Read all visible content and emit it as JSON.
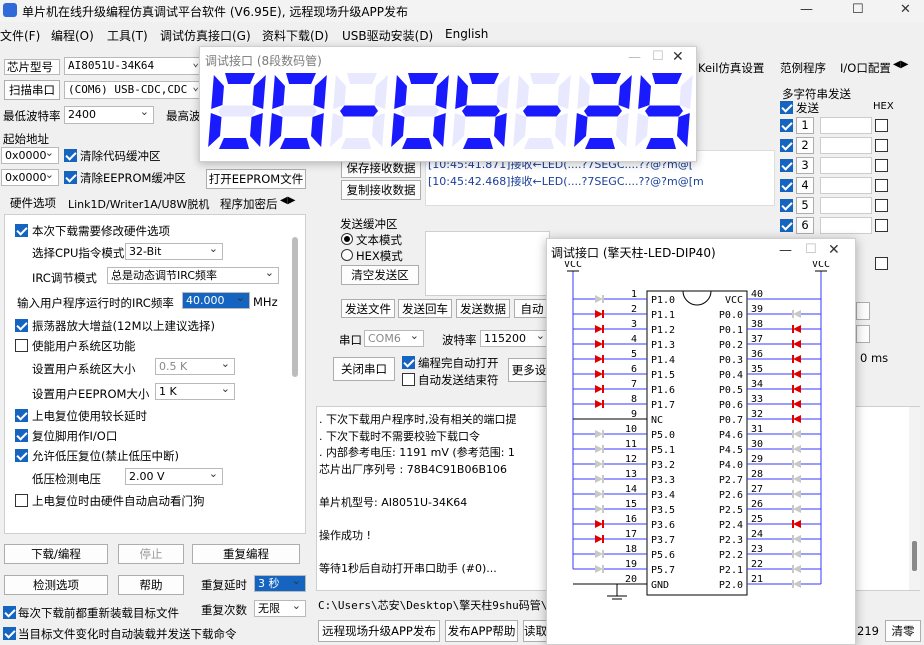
{
  "window": {
    "title": "单片机在线升级编程仿真调试平台软件 (V6.95E), 远程现场升级APP发布"
  },
  "menu": [
    "文件(F)",
    "编程(O)",
    "工具(T)",
    "调试仿真接口(G)",
    "资料下载(D)",
    "USB驱动安装(D)",
    "English"
  ],
  "left": {
    "chip_label": "芯片型号",
    "chip_value": "AI8051U-34K64",
    "scan_button": "扫描串口",
    "port_value": "(COM6) USB-CDC,CDC",
    "min_baud_label": "最低波特率",
    "min_baud_value": "2400",
    "max_baud_label": "最高波",
    "start_addr_label": "起始地址",
    "addr1": "0x0000",
    "clear_code": "清除代码缓冲区",
    "addr2": "0x0000",
    "clear_eeprom": "清除EEPROM缓冲区",
    "open_eeprom": "打开EEPROM文件",
    "tabs": [
      "硬件选项",
      "Link1D/Writer1A/U8W脱机",
      "程序加密后"
    ],
    "opts": {
      "need_modify": "本次下载需要修改硬件选项",
      "cpu_mode_label": "选择CPU指令模式",
      "cpu_mode": "32-Bit",
      "irc_label": "IRC调节模式",
      "irc_mode": "总是动态调节IRC频率",
      "freq_label": "输入用户程序运行时的IRC频率",
      "freq": "40.000",
      "freq_unit": "MHz",
      "osc_gain": "振荡器放大增益(12M以上建议选择)",
      "user_sys": "使能用户系统区功能",
      "sys_size_label": "设置用户系统区大小",
      "sys_size": "0.5 K",
      "eeprom_size_label": "设置用户EEPROM大小",
      "eeprom_size": "1   K",
      "long_delay": "上电复位使用较长延时",
      "reset_io": "复位脚用作I/O口",
      "lvr": "允许低压复位(禁止低压中断)",
      "lvd_label": "低压检测电压",
      "lvd": "2.00 V",
      "watchdog": "上电复位时由硬件自动启动看门狗"
    },
    "download_button": "下载/编程",
    "stop_button": "停止",
    "reprogram_button": "重复编程",
    "check_button": "检测选项",
    "help_button": "帮助",
    "delay_label": "重复延时",
    "delay_value": "3 秒",
    "reload_label": "每次下载前都重新装载目标文件",
    "count_label": "重复次数",
    "count_value": "无限",
    "auto_send_label": "当目标文件变化时自动装载并发送下载命令"
  },
  "top_right": {
    "keil_tab": "Keil仿真设置",
    "sample_tab": "范例程序",
    "io_tab": "I/O口配置"
  },
  "serial": {
    "save_recv": "保存接收数据",
    "copy_recv": "复制接收数据",
    "log": [
      "[10:45:41.871]接收←LED(....?7SEGC....??@?m@[",
      "[10:45:42.468]接收←LED(....?7SEGC....??@?m@[m"
    ],
    "send_label": "发送缓冲区",
    "text_mode": "文本模式",
    "hex_mode": "HEX模式",
    "clear_send": "清空发送区",
    "send_file": "发送文件",
    "send_cr": "发送回车",
    "send_data": "发送数据",
    "auto_send": "自动",
    "port_label": "串口",
    "port_value": "COM6",
    "baud_label": "波特率",
    "baud_value": "115200",
    "close_port": "关闭串口",
    "auto_open": "编程完自动打开",
    "auto_recv": "自动发送结束符",
    "more": "更多设"
  },
  "multi": {
    "title": "多字符串发送",
    "send": "发送",
    "hex": "HEX",
    "rows": [
      "1",
      "2",
      "3",
      "4",
      "5",
      "6"
    ]
  },
  "misc": {
    "unit_ms": "0 ms",
    "clear": "清零",
    "num219": "219",
    "remote_upgrade": "远程现场升级APP发布",
    "publish_help": "发布APP帮助",
    "read": "读取"
  },
  "output": {
    "lines": [
      ". 下次下载用户程序时,没有相关的端口提",
      ". 下次下载时不需要校验下载口令",
      ". 内部参考电压: 1191 mV (参考范围: 1",
      "芯片出厂序列号 : 78B4C91B06B106",
      "",
      "单片机型号: AI8051U-34K64",
      "",
      "操作成功 !",
      "",
      "等待1秒后自动打开串口助手 (#0)..."
    ],
    "path": "C:\\Users\\芯安\\Desktop\\擎天柱9shu码管\\C"
  },
  "led_window": {
    "title": "调试接口 (8段数码管)",
    "digits": "00-05-25",
    "color": "#1a1aff"
  },
  "dip_window": {
    "title": "调试接口 (擎天柱-LED-DIP40)",
    "vcc": "VCC",
    "gnd": "GND",
    "nc": "NC",
    "left_pins": [
      "P1.0",
      "P1.1",
      "P1.2",
      "P1.3",
      "P1.4",
      "P1.5",
      "P1.6",
      "P1.7",
      "NC",
      "P5.0",
      "P5.1",
      "P3.2",
      "P3.3",
      "P3.4",
      "P3.5",
      "P3.6",
      "P3.7",
      "P5.6",
      "P5.7",
      "GND"
    ],
    "right_pins": [
      "VCC",
      "P0.0",
      "P0.1",
      "P0.2",
      "P0.3",
      "P0.4",
      "P0.5",
      "P0.6",
      "P0.7",
      "P4.6",
      "P4.5",
      "P4.0",
      "P2.7",
      "P2.6",
      "P2.5",
      "P2.4",
      "P2.3",
      "P2.2",
      "P2.1",
      "P2.0"
    ],
    "left_led": [
      "off",
      "on",
      "on",
      "on",
      "on",
      "on",
      "on",
      "on",
      "none",
      "off",
      "off",
      "off",
      "off",
      "off",
      "off",
      "on",
      "on",
      "off",
      "off",
      "none"
    ],
    "right_led": [
      "none",
      "off",
      "on",
      "on",
      "on",
      "on",
      "on",
      "on",
      "on",
      "off",
      "off",
      "off",
      "off",
      "off",
      "off",
      "on",
      "off",
      "off",
      "off",
      "off"
    ],
    "led_on": "#e00000",
    "led_off": "#c8c8c8"
  }
}
